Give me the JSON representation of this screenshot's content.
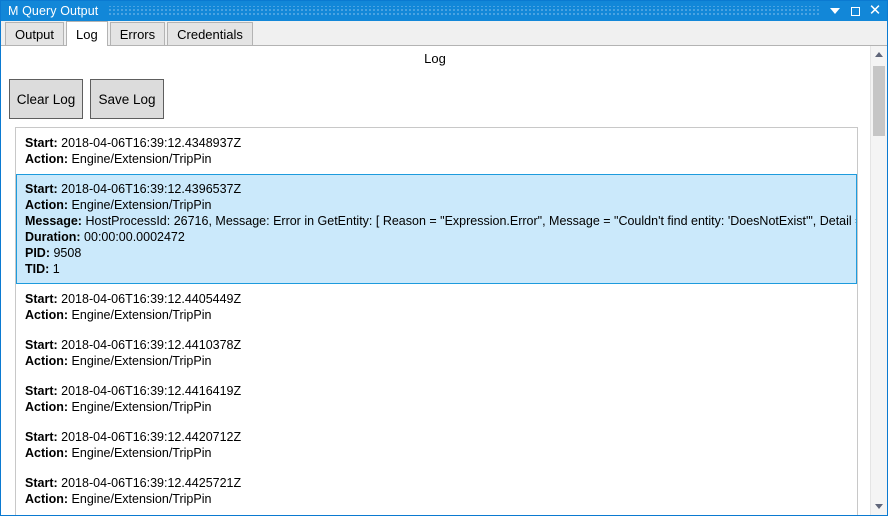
{
  "window": {
    "title": "M Query Output",
    "controls": [
      {
        "name": "minimize-dropdown",
        "glyph": "chevron-down"
      },
      {
        "name": "maximize",
        "glyph": "square"
      },
      {
        "name": "close",
        "glyph": "times"
      }
    ]
  },
  "tabs": [
    {
      "label": "Output",
      "active": false
    },
    {
      "label": "Log",
      "active": true
    },
    {
      "label": "Errors",
      "active": false
    },
    {
      "label": "Credentials",
      "active": false
    }
  ],
  "panel": {
    "header": "Log",
    "buttons": [
      {
        "label": "Clear Log"
      },
      {
        "label": "Save Log"
      }
    ]
  },
  "labels": {
    "start": "Start:",
    "action": "Action:",
    "message": "Message:",
    "duration": "Duration:",
    "pid": "PID:",
    "tid": "TID:"
  },
  "log_entries": [
    {
      "selected": false,
      "start": "2018-04-06T16:39:12.4348937Z",
      "action": "Engine/Extension/TripPin"
    },
    {
      "selected": true,
      "start": "2018-04-06T16:39:12.4396537Z",
      "action": "Engine/Extension/TripPin",
      "message": "HostProcessId: 26716, Message: Error in GetEntity: [ Reason = \"Expression.Error\", Message = \"Couldn't find entity: 'DoesNotExist'\", Detail = null ]",
      "duration": "00:00:00.0002472",
      "pid": "9508",
      "tid": "1"
    },
    {
      "selected": false,
      "start": "2018-04-06T16:39:12.4405449Z",
      "action": "Engine/Extension/TripPin"
    },
    {
      "selected": false,
      "start": "2018-04-06T16:39:12.4410378Z",
      "action": "Engine/Extension/TripPin"
    },
    {
      "selected": false,
      "start": "2018-04-06T16:39:12.4416419Z",
      "action": "Engine/Extension/TripPin"
    },
    {
      "selected": false,
      "start": "2018-04-06T16:39:12.4420712Z",
      "action": "Engine/Extension/TripPin"
    },
    {
      "selected": false,
      "start": "2018-04-06T16:39:12.4425721Z",
      "action": "Engine/Extension/TripPin"
    }
  ],
  "colors": {
    "titlebar": "#1287d8",
    "selection_fill": "#cbe9fb",
    "selection_border": "#1d9bdd",
    "button_face": "#dcdcdc"
  }
}
